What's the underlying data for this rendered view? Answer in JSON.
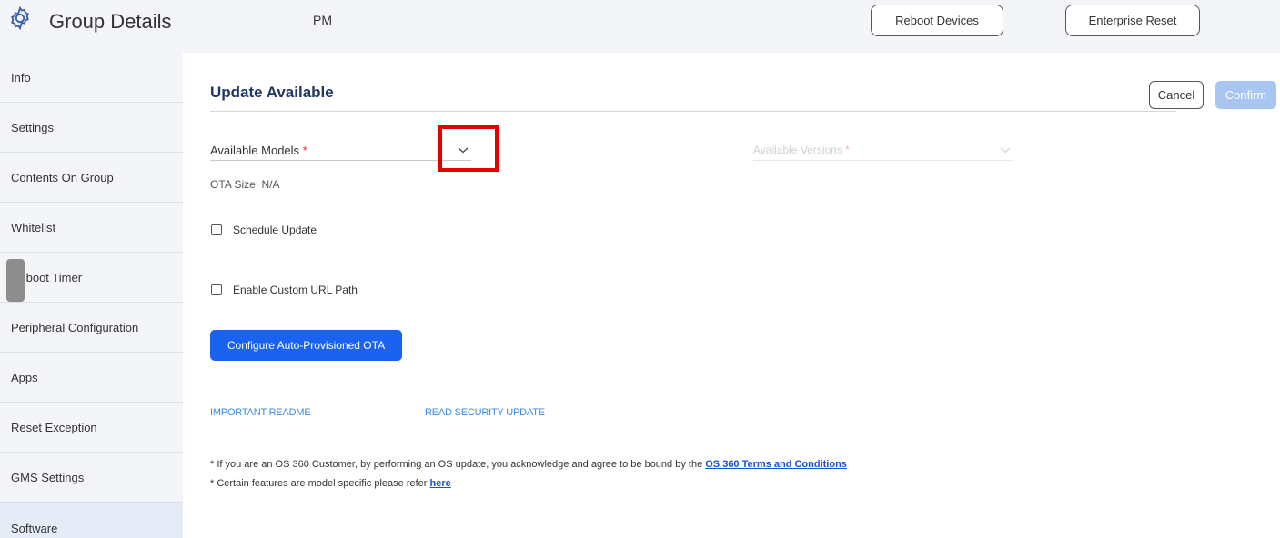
{
  "header": {
    "title": "Group Details",
    "subtitle": "PM",
    "reboot_label": "Reboot Devices",
    "enterprise_reset_label": "Enterprise Reset"
  },
  "sidebar": {
    "items": [
      {
        "label": "Info"
      },
      {
        "label": "Settings"
      },
      {
        "label": "Contents On Group"
      },
      {
        "label": "Whitelist"
      },
      {
        "label": "Reboot Timer"
      },
      {
        "label": "Peripheral Configuration"
      },
      {
        "label": "Apps"
      },
      {
        "label": "Reset Exception"
      },
      {
        "label": "GMS Settings"
      },
      {
        "label": "Software"
      }
    ],
    "active": "Software"
  },
  "main": {
    "title": "Update Available",
    "cancel_label": "Cancel",
    "confirm_label": "Confirm",
    "models_label": "Available Models",
    "versions_label": "Available Versions",
    "required_mark": "*",
    "ota_size": "OTA Size: N/A",
    "schedule_label": "Schedule Update",
    "schedule_checked": false,
    "custom_url_label": "Enable Custom URL Path",
    "custom_url_checked": false,
    "ota_button_label": "Configure Auto-Provisioned OTA",
    "readme_link": "IMPORTANT README",
    "security_link": "READ SECURITY UPDATE",
    "note1_text": "* If you are an OS 360 Customer, by performing an OS update, you acknowledge and agree to be bound by the ",
    "note1_link": "OS 360 Terms and Conditions",
    "note2_text": "* Certain features are model specific please refer ",
    "note2_link": "here"
  },
  "icons": {
    "header_icon": "gear-icon",
    "dropdown_icon": "chevron-down-icon",
    "handle_icon": "collapse-handle"
  },
  "colors": {
    "accent": "#1b62f0",
    "confirm_disabled": "#a9c6f2",
    "title": "#1f3864",
    "highlight": "#e60000",
    "link": "#3d8bd9"
  }
}
